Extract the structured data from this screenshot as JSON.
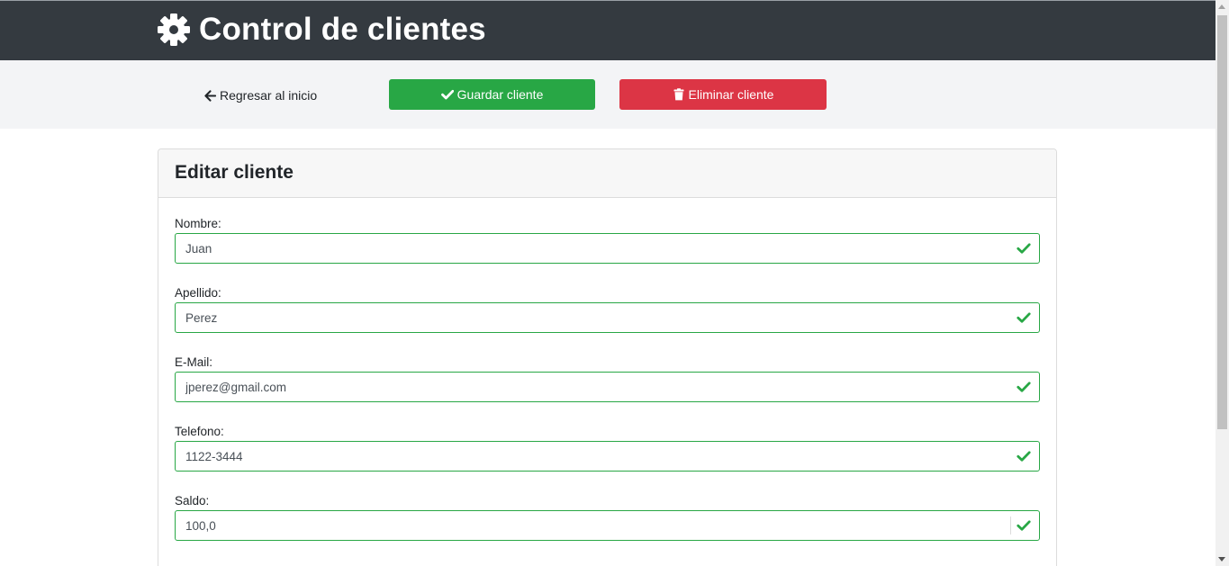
{
  "header": {
    "title": "Control de clientes",
    "icon": "gear-icon"
  },
  "toolbar": {
    "back_label": "Regresar al inicio",
    "back_icon": "arrow-left-icon",
    "save_label": "Guardar cliente",
    "save_icon": "check-icon",
    "delete_label": "Eliminar cliente",
    "delete_icon": "trash-icon"
  },
  "form": {
    "title": "Editar cliente",
    "fields": [
      {
        "label": "Nombre:",
        "value": "Juan"
      },
      {
        "label": "Apellido:",
        "value": "Perez"
      },
      {
        "label": "E-Mail:",
        "value": "jperez@gmail.com"
      },
      {
        "label": "Telefono:",
        "value": "1122-3444"
      },
      {
        "label": "Saldo:",
        "value": "100,0"
      }
    ]
  },
  "colors": {
    "navbar": "#343a40",
    "success": "#28a745",
    "danger": "#dc3545",
    "toolbar_bg": "#f3f4f6"
  }
}
